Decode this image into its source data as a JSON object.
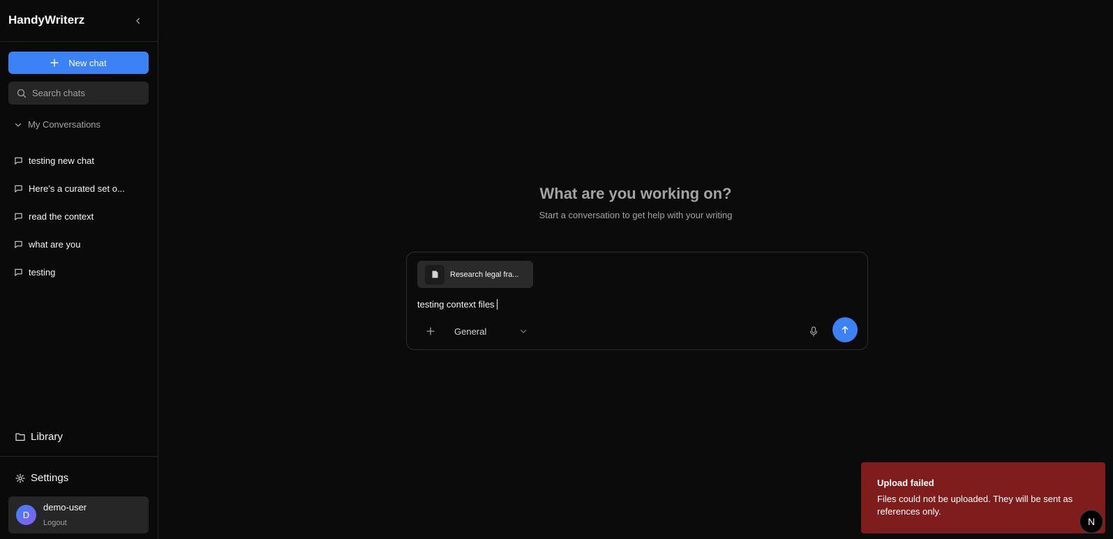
{
  "sidebar": {
    "brand": "HandyWriterz",
    "new_chat_label": "New chat",
    "search_placeholder": "Search chats",
    "section_label": "My Conversations",
    "conversations": [
      "testing new chat",
      "Here’s a curated set o...",
      "read the context",
      "what are you",
      "testing"
    ],
    "library_label": "Library",
    "settings_label": "Settings",
    "user": {
      "initial": "D",
      "name": "demo-user",
      "logout_label": "Logout"
    }
  },
  "main": {
    "title": "What are you working on?",
    "subtitle": "Start a conversation to get help with your writing",
    "composer": {
      "attachment_name": "Research legal fra...",
      "message_text": "testing context files",
      "mode_selected": "General"
    }
  },
  "toast": {
    "title": "Upload failed",
    "body": "Files could not be uploaded. They will be sent as references only."
  },
  "badge": {
    "letter": "N"
  },
  "colors": {
    "accent": "#3b82f6",
    "toast_bg": "#7f1d1d",
    "background": "#0b0b0b"
  },
  "icons": [
    "chevron-left-icon",
    "plus-icon",
    "search-icon",
    "chevron-down-icon",
    "message-square-icon",
    "folder-icon",
    "gear-icon",
    "file-icon",
    "mic-icon",
    "arrow-up-icon"
  ]
}
